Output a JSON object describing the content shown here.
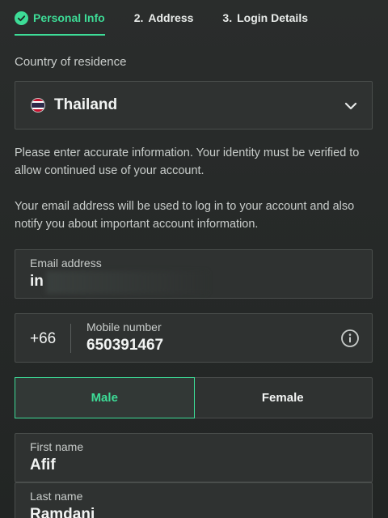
{
  "steps": [
    {
      "label": "Personal Info",
      "num": ""
    },
    {
      "label": "Address",
      "num": "2."
    },
    {
      "label": "Login Details",
      "num": "3."
    }
  ],
  "country": {
    "label": "Country of residence",
    "value": "Thailand"
  },
  "info": {
    "identity": "Please enter accurate information. Your identity must be verified to allow continued use of your account.",
    "email_notice": "Your email address will be used to log in to your account and also notify you about important account information."
  },
  "email": {
    "label": "Email address",
    "value": "in"
  },
  "phone": {
    "code": "+66",
    "label": "Mobile number",
    "value": "650391467"
  },
  "gender": {
    "male": "Male",
    "female": "Female",
    "selected": "Male"
  },
  "first_name": {
    "label": "First name",
    "value": "Afif"
  },
  "last_name": {
    "label": "Last name",
    "value": "Ramdani"
  },
  "colors": {
    "accent": "#3ddc97",
    "background": "#262928",
    "field": "#2f3231"
  }
}
